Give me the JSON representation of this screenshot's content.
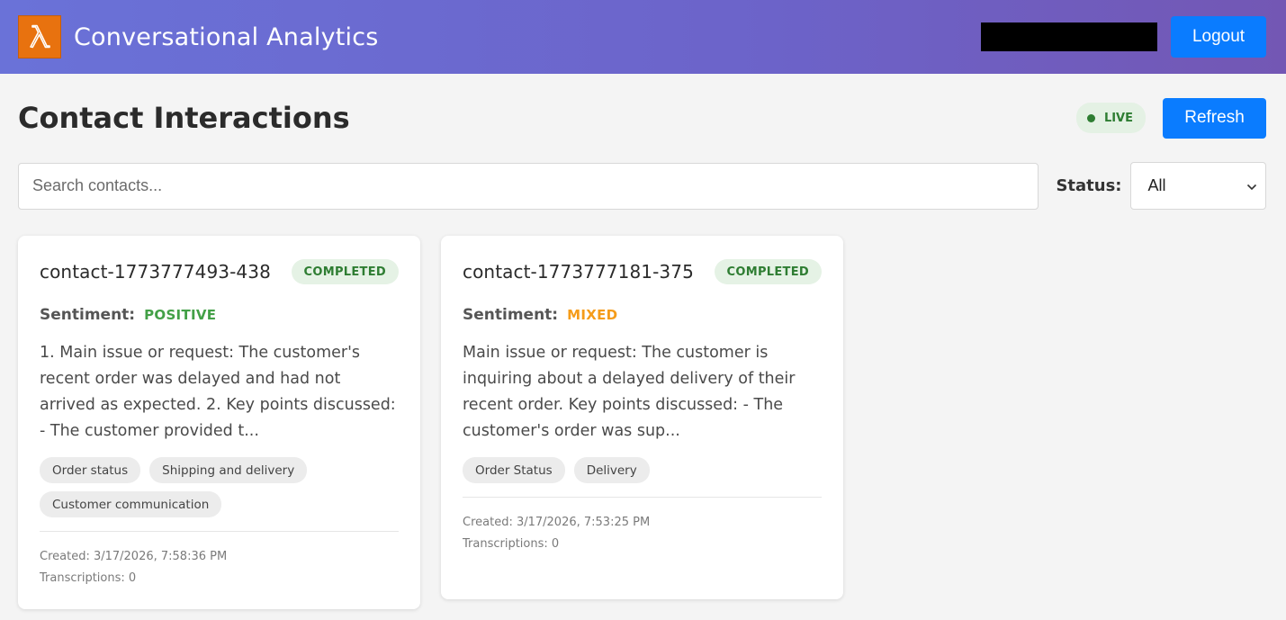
{
  "header": {
    "title": "Conversational Analytics",
    "logo_icon": "lambda-icon",
    "logout_label": "Logout"
  },
  "page": {
    "title": "Contact Interactions",
    "live_label": "LIVE",
    "refresh_label": "Refresh"
  },
  "filters": {
    "search_placeholder": "Search contacts...",
    "search_value": "",
    "status_label": "Status:",
    "status_selected": "All"
  },
  "colors": {
    "positive": "#43a047",
    "mixed": "#f59c1a",
    "completed_bg": "#e5f2e5",
    "completed_text": "#2e7d32",
    "accent": "#0a7cff"
  },
  "contacts": [
    {
      "id": "contact-1773777493-438",
      "status": "COMPLETED",
      "sentiment_label": "Sentiment:",
      "sentiment": "POSITIVE",
      "summary": "1. Main issue or request: The customer's recent order was delayed and had not arrived as expected. 2. Key points discussed: - The customer provided t...",
      "tags": [
        "Order status",
        "Shipping and delivery",
        "Customer communication"
      ],
      "created": "Created: 3/17/2026, 7:58:36 PM",
      "transcriptions": "Transcriptions: 0"
    },
    {
      "id": "contact-1773777181-375",
      "status": "COMPLETED",
      "sentiment_label": "Sentiment:",
      "sentiment": "MIXED",
      "summary": "Main issue or request: The customer is inquiring about a delayed delivery of their recent order. Key points discussed: - The customer's order was sup...",
      "tags": [
        "Order Status",
        "Delivery"
      ],
      "created": "Created: 3/17/2026, 7:53:25 PM",
      "transcriptions": "Transcriptions: 0"
    }
  ]
}
